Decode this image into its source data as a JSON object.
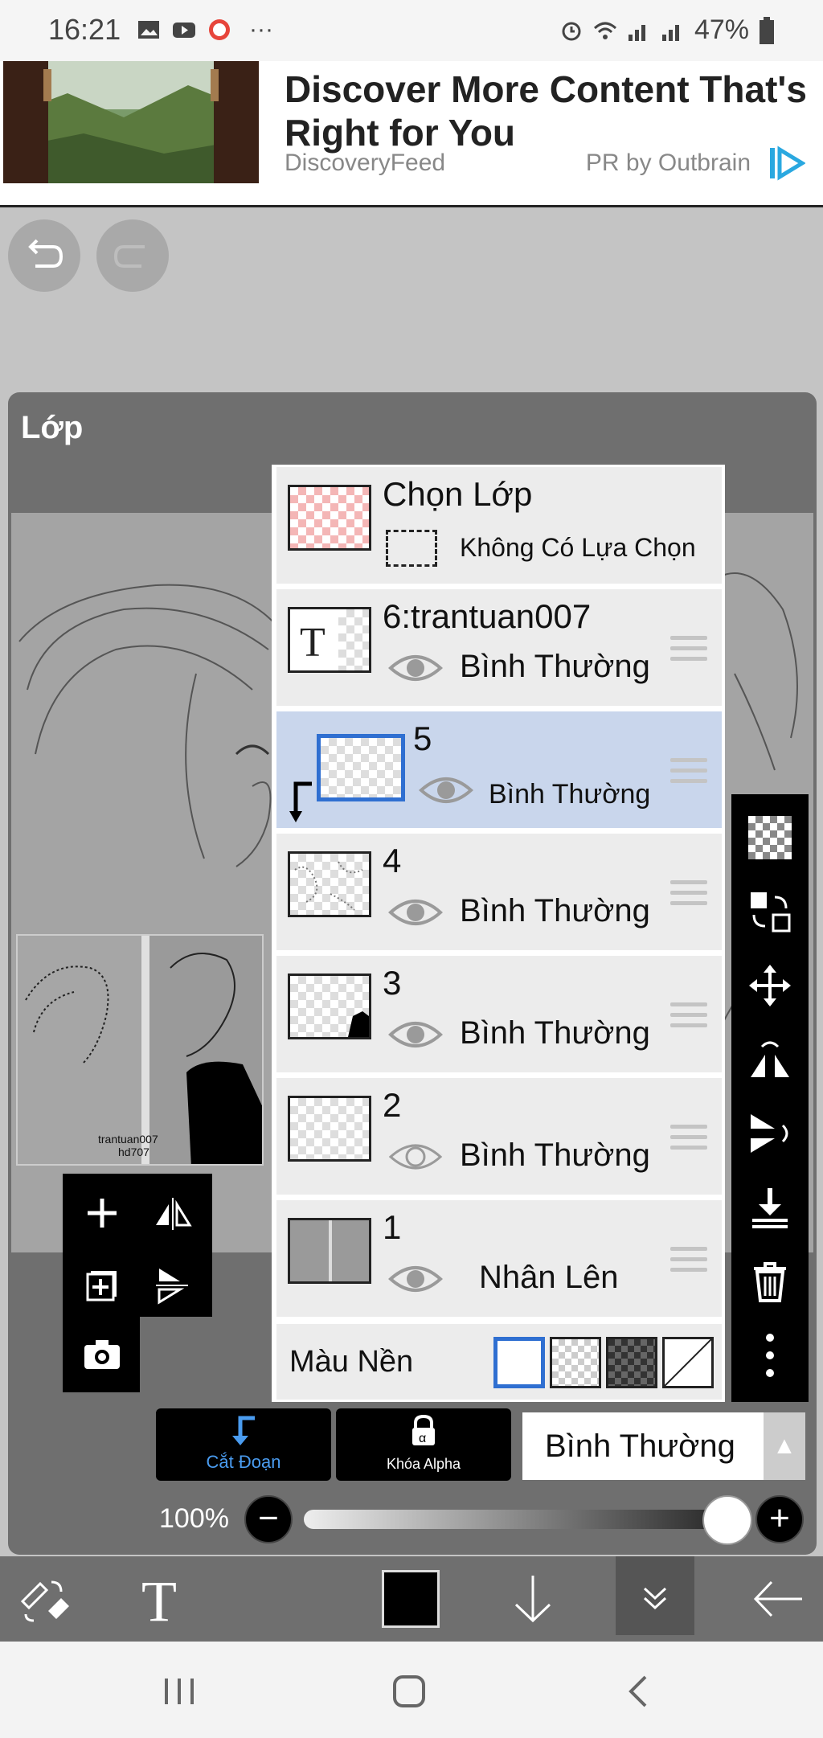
{
  "status_bar": {
    "time": "16:21",
    "battery": "47%",
    "more": "···"
  },
  "ad": {
    "title": "Discover More Content That's Right for You",
    "source": "DiscoveryFeed",
    "provider": "PR by Outbrain"
  },
  "panel": {
    "title": "Lớp"
  },
  "selection": {
    "title": "Chọn Lớp",
    "status": "Không Có Lựa Chọn"
  },
  "layers": [
    {
      "name": "6:trantuan007",
      "mode": "Bình Thường",
      "visible": true,
      "type": "text"
    },
    {
      "name": "5",
      "mode": "Bình Thường",
      "visible": true,
      "selected": true,
      "clipped": true
    },
    {
      "name": "4",
      "mode": "Bình Thường",
      "visible": true
    },
    {
      "name": "3",
      "mode": "Bình Thường",
      "visible": true
    },
    {
      "name": "2",
      "mode": "Bình Thường",
      "visible": false
    },
    {
      "name": "1",
      "mode": "Nhân Lên",
      "visible": true
    }
  ],
  "background_color": {
    "label": "Màu Nền"
  },
  "thumbnail": {
    "watermark_line1": "trantuan007",
    "watermark_line2": "hd707"
  },
  "bottom": {
    "clip_label": "Cắt Đoạn",
    "alpha_lock_label": "Khóa Alpha",
    "blend_mode": "Bình Thường",
    "opacity": "100%"
  },
  "colors": {
    "accent": "#2f6fd1",
    "selected_row": "#c9d6ec",
    "panel": "#6f6f6f"
  }
}
